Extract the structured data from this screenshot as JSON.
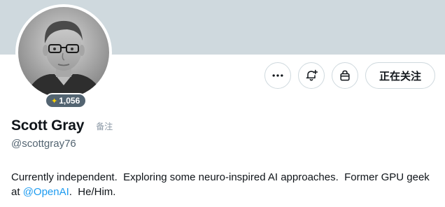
{
  "profile": {
    "display_name": "Scott Gray",
    "note_label": "备注",
    "handle": "@scottgray76",
    "badge_count": "1,056",
    "bio": {
      "text_before": "Currently independent.  Exploring some neuro-inspired AI approaches.  Former GPU geek at ",
      "mention": "@OpenAI",
      "text_after": ".  He/Him."
    }
  },
  "actions": {
    "more_icon": "more-horizontal-icon",
    "notify_icon": "bell-plus-icon",
    "shop_icon": "shopping-bag-icon",
    "follow_label": "正在关注"
  },
  "colors": {
    "banner": "#cfd9de",
    "link": "#1d9bf0",
    "badge": "#536471",
    "secondary_text": "#536471"
  }
}
